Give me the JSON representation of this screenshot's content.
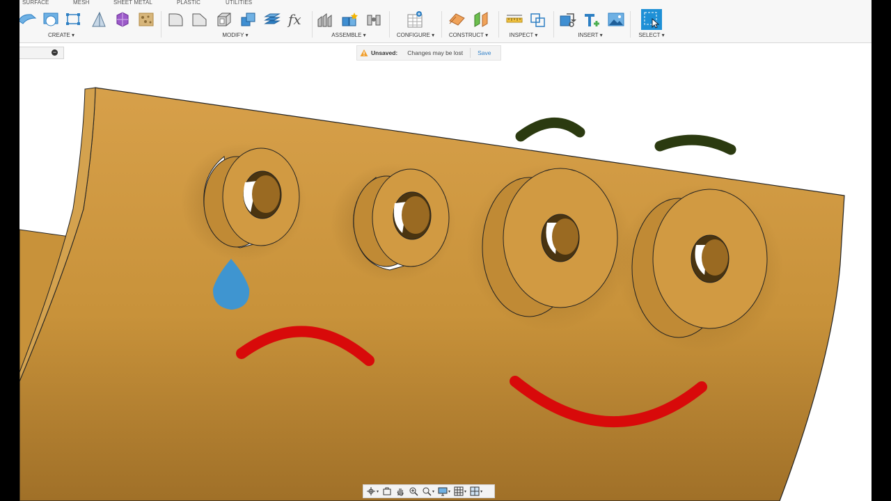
{
  "workspace_tabs": [
    "SURFACE",
    "MESH",
    "SHEET METAL",
    "PLASTIC",
    "UTILITIES"
  ],
  "toolbar_groups": {
    "create": "CREATE",
    "modify": "MODIFY",
    "assemble": "ASSEMBLE",
    "configure": "CONFIGURE",
    "construct": "CONSTRUCT",
    "inspect": "INSPECT",
    "insert": "INSERT",
    "select": "SELECT"
  },
  "colors": {
    "toolbar_icon_blue": "#2d7fc3",
    "model_orange": "#c8923a",
    "annotation_red": "#d80a0a",
    "annotation_dark_green": "#2b3a10",
    "annotation_blue": "#3f95d0"
  },
  "unsaved": {
    "label": "Unsaved:",
    "message": "Changes may be lost",
    "save_label": "Save"
  },
  "icons": {
    "collapse": "minus-circle-icon",
    "expand": "plus-circle-icon"
  }
}
